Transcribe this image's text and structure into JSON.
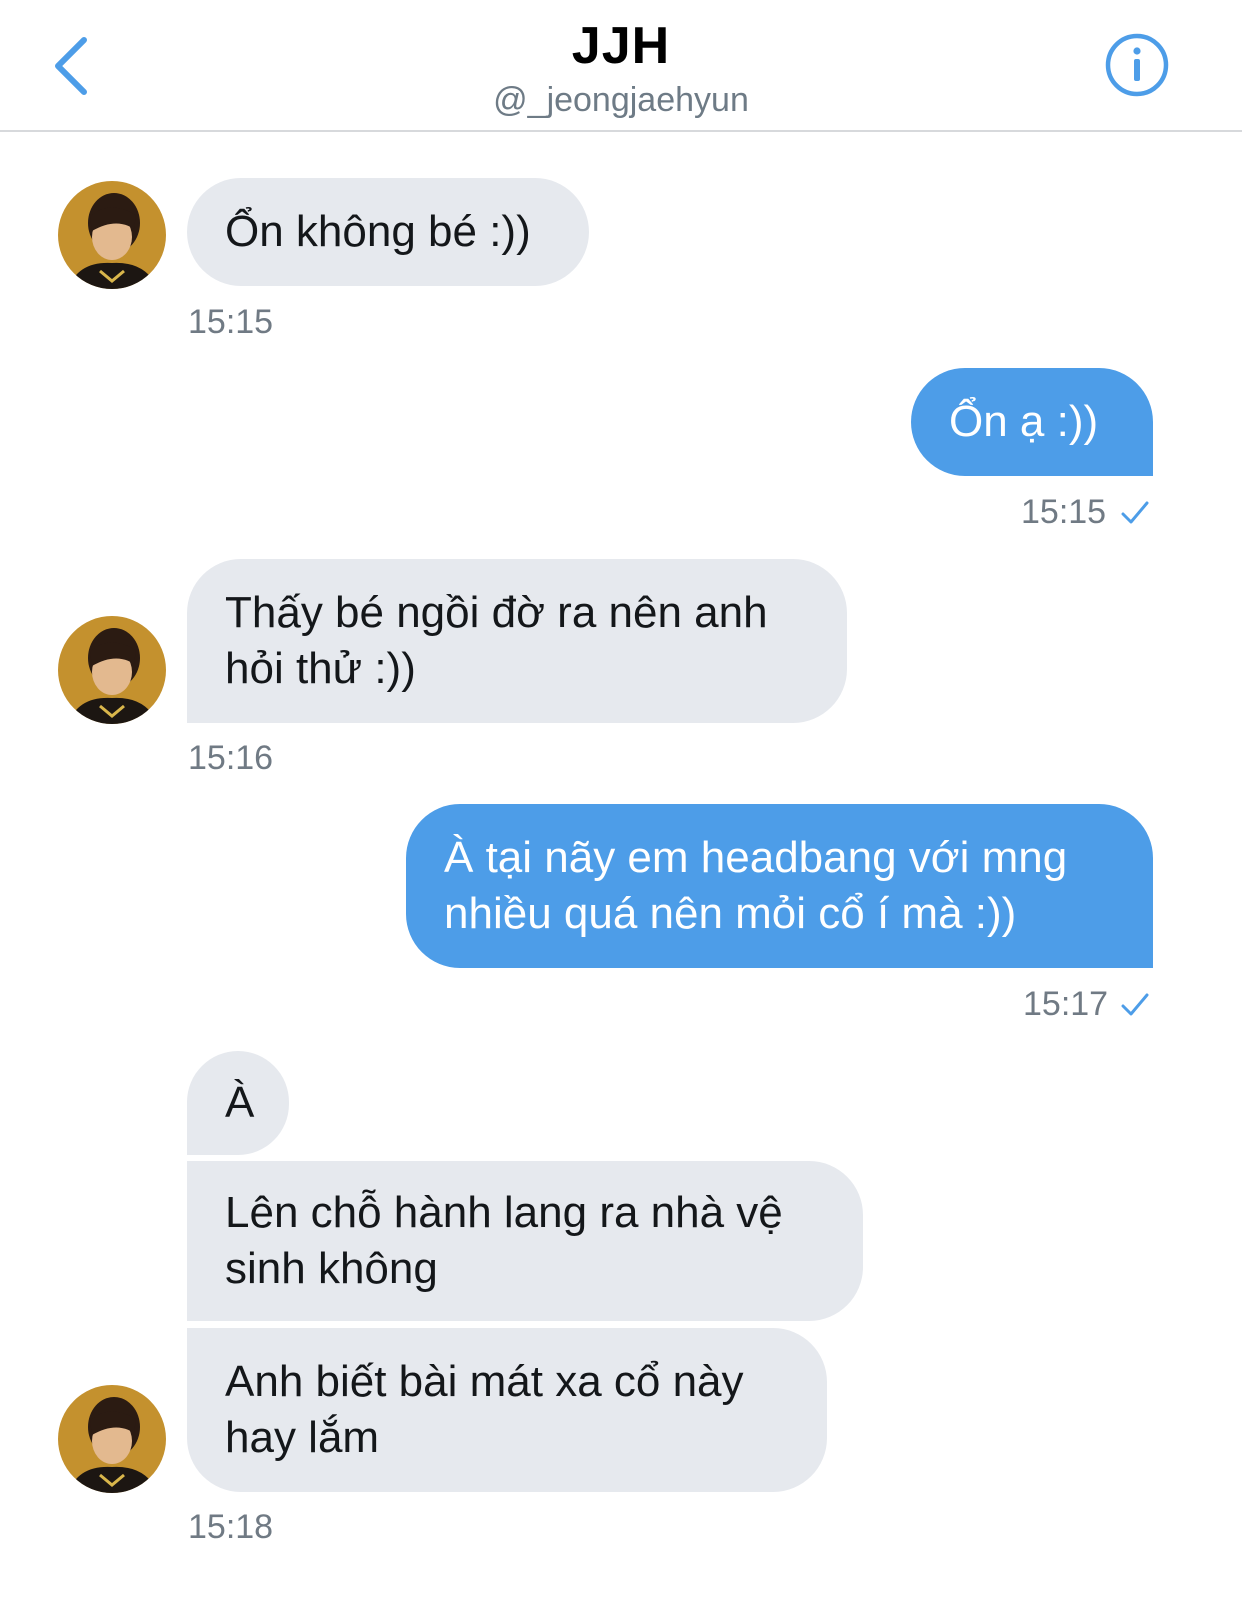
{
  "header": {
    "title": "JJH",
    "handle": "@_jeongjaehyun",
    "back_icon": "chevron-left-icon",
    "info_icon": "info-circle-icon"
  },
  "colors": {
    "accent": "#4d9de8",
    "incoming_bubble": "#e6e9ee",
    "outgoing_bubble": "#4d9de8",
    "timestamp": "#707a84"
  },
  "messages": [
    {
      "direction": "in",
      "text": "Ổn không bé :))",
      "time": "15:15"
    },
    {
      "direction": "out",
      "text": "Ổn ạ :))",
      "time": "15:15",
      "read_icon": "check-icon"
    },
    {
      "direction": "in",
      "lines": [
        "Thấy bé ngồi đờ ra nên anh",
        "hỏi thử :))"
      ],
      "time": "15:16"
    },
    {
      "direction": "out",
      "lines": [
        "À tại nãy em headbang với mng",
        "nhiều quá nên mỏi cổ í mà :))"
      ],
      "time": "15:17",
      "read_icon": "check-icon"
    },
    {
      "direction": "in",
      "text": "À"
    },
    {
      "direction": "in",
      "lines": [
        "Lên chỗ hành lang ra nhà vệ",
        "sinh không"
      ]
    },
    {
      "direction": "in",
      "lines": [
        "Anh biết bài mát xa cổ này",
        "hay lắm"
      ],
      "time": "15:18"
    }
  ]
}
